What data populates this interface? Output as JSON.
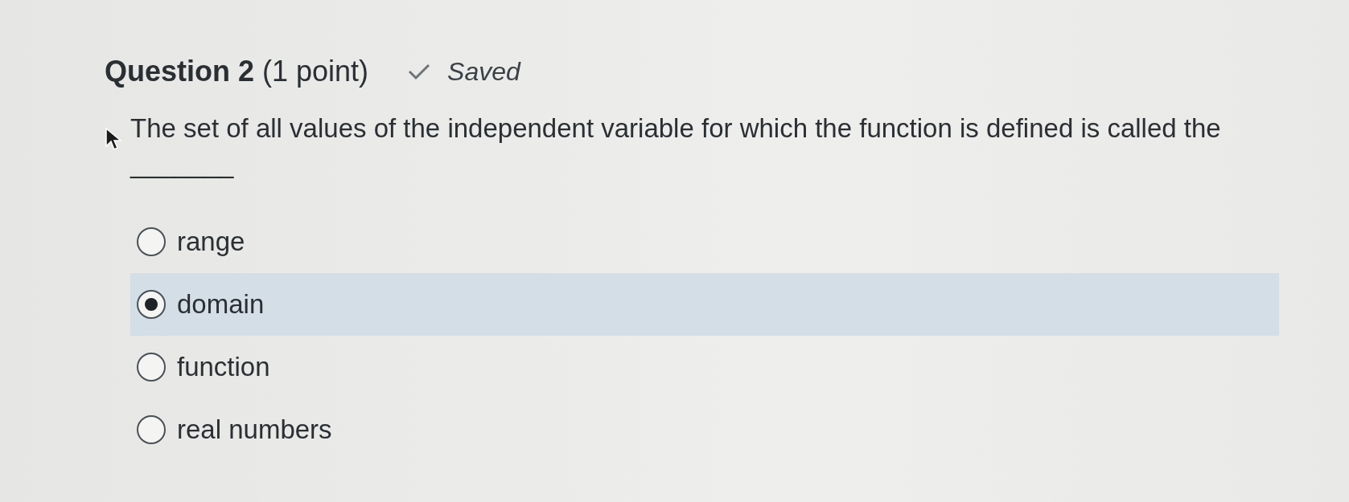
{
  "question": {
    "title": "Question 2",
    "points": "(1 point)",
    "status": "Saved",
    "text": "The set of all values of the independent variable for which the function is defined is called the _______"
  },
  "options": [
    {
      "label": "range",
      "selected": false
    },
    {
      "label": "domain",
      "selected": true
    },
    {
      "label": "function",
      "selected": false
    },
    {
      "label": "real numbers",
      "selected": false
    }
  ]
}
